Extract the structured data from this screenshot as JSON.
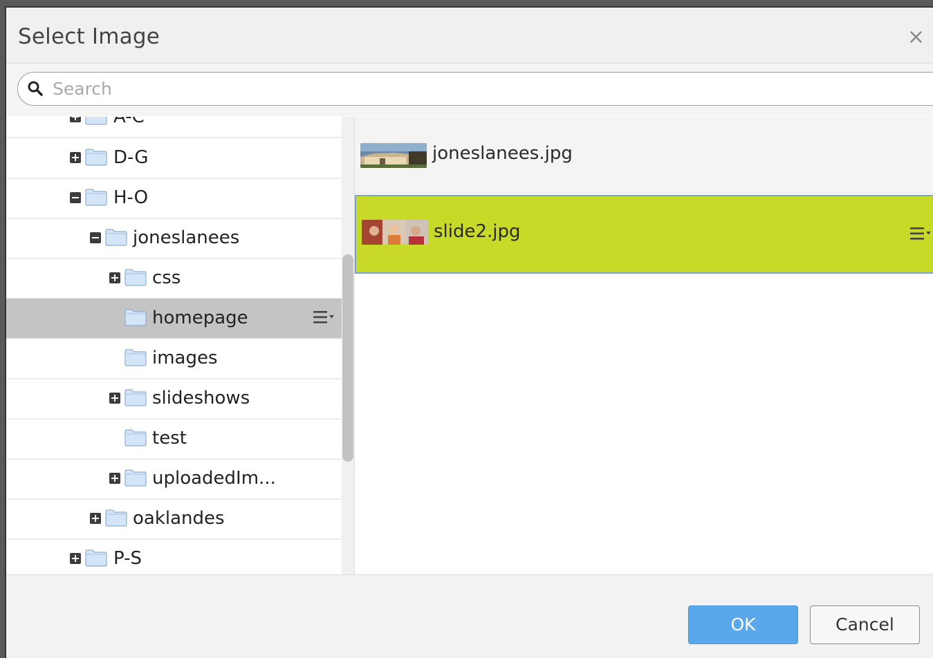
{
  "dialog": {
    "title": "Select Image",
    "close_symbol": "×"
  },
  "search": {
    "placeholder": "Search",
    "value": ""
  },
  "tree": {
    "items": [
      {
        "label": "A-C",
        "toggle": "plus",
        "depth": 0
      },
      {
        "label": "D-G",
        "toggle": "plus",
        "depth": 0
      },
      {
        "label": "H-O",
        "toggle": "minus",
        "depth": 0
      },
      {
        "label": "joneslanees",
        "toggle": "minus",
        "depth": 1
      },
      {
        "label": "css",
        "toggle": "plus",
        "depth": 2
      },
      {
        "label": "homepage",
        "toggle": "none",
        "depth": 2,
        "selected": true
      },
      {
        "label": "images",
        "toggle": "none",
        "depth": 2
      },
      {
        "label": "slideshows",
        "toggle": "plus",
        "depth": 2
      },
      {
        "label": "test",
        "toggle": "none",
        "depth": 2
      },
      {
        "label": "uploadedIm...",
        "toggle": "plus",
        "depth": 2
      },
      {
        "label": "oaklandes",
        "toggle": "plus",
        "depth": 1
      },
      {
        "label": "P-S",
        "toggle": "plus",
        "depth": 0
      }
    ]
  },
  "files": {
    "items": [
      {
        "name": "joneslanees.jpg",
        "selected": false
      },
      {
        "name": "slide2.jpg",
        "selected": true
      }
    ]
  },
  "footer": {
    "ok_label": "OK",
    "cancel_label": "Cancel"
  },
  "colors": {
    "selected_file_bg": "#c8da28",
    "selected_folder_bg": "#c4c4c4",
    "ok_button_bg": "#5aa8ec"
  },
  "icons": [
    "search-icon",
    "close-icon",
    "folder-icon",
    "expand-icon",
    "collapse-icon",
    "menu-icon"
  ]
}
